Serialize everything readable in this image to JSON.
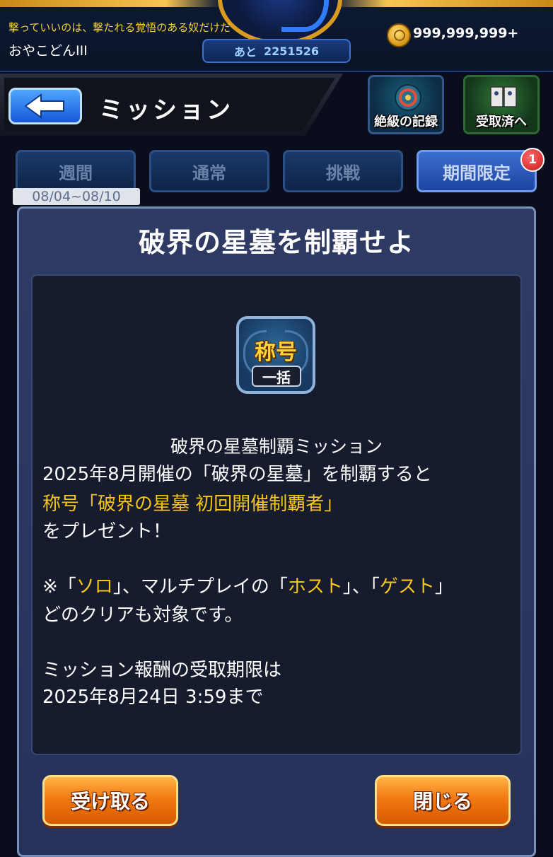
{
  "header": {
    "motto": "撃っていいのは、撃たれる覚悟のある奴だけだ",
    "player_name": "おやこどんIII",
    "exp_prefix": "あと",
    "exp_value": "2251526",
    "coins": "999,999,999+"
  },
  "title_bar": {
    "title": "ミッション",
    "record_label": "絶級の記録",
    "received_label": "受取済へ"
  },
  "tabs": [
    {
      "label": "週間"
    },
    {
      "label": "通常"
    },
    {
      "label": "挑戦"
    },
    {
      "label": "期間限定",
      "badge": "1"
    }
  ],
  "date_range": "08/04~08/10",
  "dialog": {
    "title": "破界の星墓を制覇せよ",
    "reward": {
      "main": "称号",
      "sub": "一括"
    },
    "body": {
      "mission_name": "破界の星墓制覇ミッション",
      "line1": "2025年8月開催の「破界の星墓」を制覇すると",
      "line2_highlight": "称号「破界の星墓 初回開催制覇者」",
      "line3": "をプレゼント！",
      "note_prefix": "※「",
      "note_solo": "ソロ",
      "note_mid": "」、マルチプレイの「",
      "note_host": "ホスト",
      "note_sep": "」、「",
      "note_guest": "ゲスト",
      "note_end": "」",
      "note_line2": "どのクリアも対象です。",
      "deadline_line1": "ミッション報酬の受取期限は",
      "deadline_line2": "2025年8月24日 3:59まで"
    },
    "receive_button": "受け取る",
    "close_button": "閉じる"
  },
  "colors": {
    "accent_gold": "#f5c518",
    "button_orange": "#f07a12",
    "tab_active": "#3c6fd0",
    "panel": "#26325a"
  }
}
